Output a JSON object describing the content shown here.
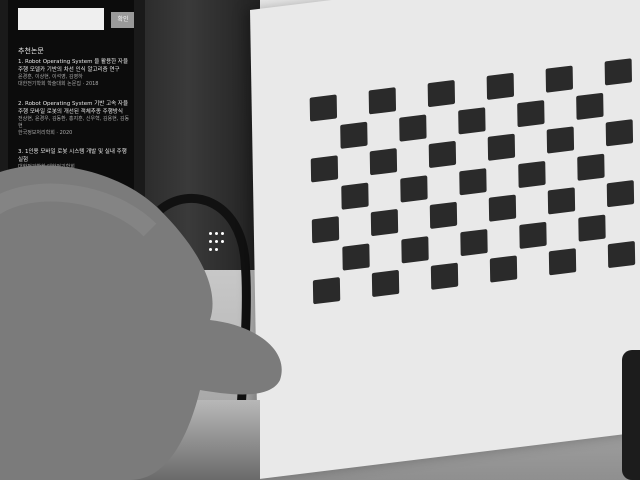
{
  "monitor": {
    "search_button": "확인",
    "list_title": "추천논문",
    "items": [
      {
        "title": "1. Robot Operating System 을 활용한 자율주행 모델카 기반의 차선 인식 알고리즘 연구",
        "authors": "윤경훈, 이상현, 이석영, 김영하",
        "venue": "대한전기학회 학술대회 논문집",
        "year": "2018"
      },
      {
        "title": "2. Robot Operating System 기반 고속 자율주행 모바일 로봇의 개선된 객체추종 주행방식",
        "authors": "전상현, 윤경우, 김동환, 홍지훈, 신우혁, 김용현, 김동현",
        "venue": "한국정보처리학회",
        "year": "2020"
      },
      {
        "title": "3. 1인용 모바일 로봇 시스템 개발 및 실내 주행 실험",
        "authors": "",
        "venue": "대한전기학회 대한전기학회",
        "year": ""
      }
    ]
  },
  "checkerboard": {
    "rows": 7,
    "cols": 11
  }
}
